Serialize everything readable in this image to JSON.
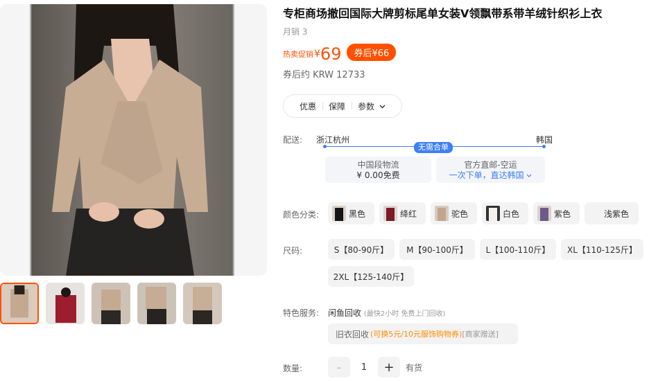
{
  "product": {
    "title": "专柜商场撤回国际大牌剪标尾单女装V领飘带系带羊绒针织衫上衣",
    "monthly_sales": "月销 3",
    "promo_label": "热卖促销",
    "currency": "¥",
    "price": "69",
    "coupon_price": "券后¥66",
    "krw_price": "券后约 KRW 12733"
  },
  "tabs": [
    {
      "label": "优惠"
    },
    {
      "label": "保障"
    },
    {
      "label": "参数"
    }
  ],
  "shipping": {
    "label": "配送:",
    "origin": "浙江杭州",
    "destination": "韩国",
    "badge": "无需合单",
    "domestic_title": "中国段物流",
    "domestic_fee": "¥ 0.00免费",
    "intl_title": "官方直邮-空运",
    "intl_link": "一次下单，直达韩国"
  },
  "colors": {
    "label": "颜色分类:",
    "options": [
      "黑色",
      "绛红",
      "驼色",
      "白色",
      "紫色",
      "浅紫色"
    ]
  },
  "sizes": {
    "label": "尺码:",
    "options": [
      "S【80-90斤】",
      "M【90-100斤】",
      "L【100-110斤】",
      "XL【110-125斤】",
      "2XL【125-140斤】"
    ]
  },
  "service": {
    "label": "特色服务:",
    "main": "闲鱼回收",
    "note": "(最快2小时 免费上门回收)",
    "box_main": "旧衣回收",
    "box_orange": "(可换5元/10元服饰购物券)",
    "box_grey": "[商家赠送]"
  },
  "quantity": {
    "label": "数量:",
    "minus": "-",
    "value": "1",
    "plus": "+",
    "stock": "有货"
  },
  "theme": {
    "accent": "#ff5000",
    "link_blue": "#3d7ff5"
  }
}
